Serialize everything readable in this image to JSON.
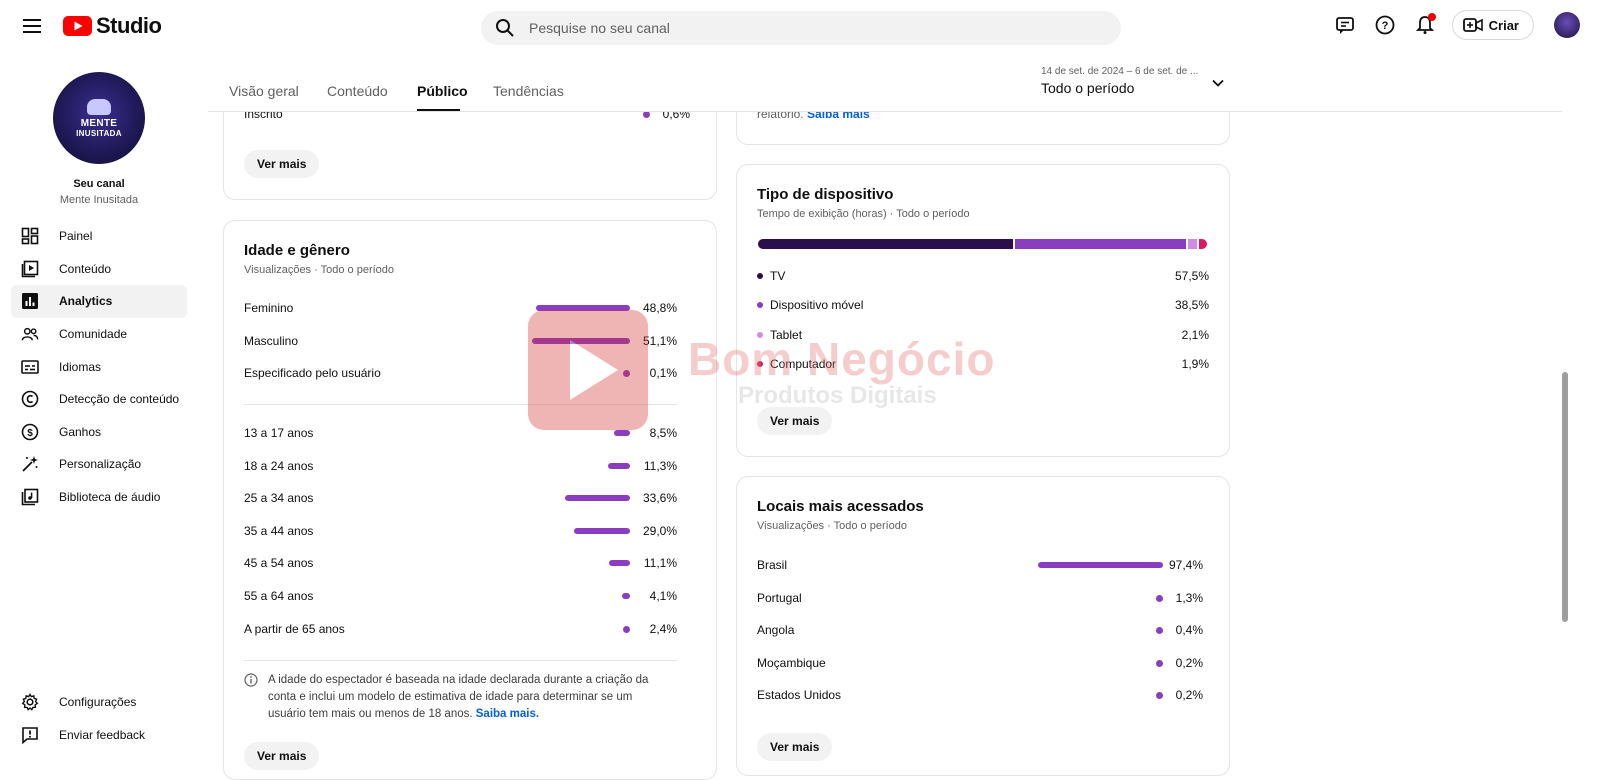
{
  "header": {
    "logo_text": "Studio",
    "search_placeholder": "Pesquise no seu canal",
    "create_label": "Criar"
  },
  "sidebar": {
    "channel_avatar_line1": "MENTE",
    "channel_avatar_line2": "INUSITADA",
    "channel_title": "Seu canal",
    "channel_name": "Mente Inusitada",
    "items": [
      {
        "label": "Painel",
        "icon": "dashboard-icon"
      },
      {
        "label": "Conteúdo",
        "icon": "content-icon"
      },
      {
        "label": "Analytics",
        "icon": "analytics-icon",
        "active": true
      },
      {
        "label": "Comunidade",
        "icon": "community-icon"
      },
      {
        "label": "Idiomas",
        "icon": "subtitles-icon"
      },
      {
        "label": "Detecção de conteúdo",
        "icon": "copyright-icon"
      },
      {
        "label": "Ganhos",
        "icon": "dollar-icon"
      },
      {
        "label": "Personalização",
        "icon": "magic-wand-icon"
      },
      {
        "label": "Biblioteca de áudio",
        "icon": "audio-library-icon"
      }
    ],
    "bottom_items": [
      {
        "label": "Configurações",
        "icon": "gear-icon"
      },
      {
        "label": "Enviar feedback",
        "icon": "feedback-icon"
      }
    ]
  },
  "tabs": [
    {
      "label": "Visão geral"
    },
    {
      "label": "Conteúdo"
    },
    {
      "label": "Público",
      "active": true
    },
    {
      "label": "Tendências"
    }
  ],
  "period": {
    "range": "14 de set. de 2024 – 6 de set. de ...",
    "label": "Todo o período"
  },
  "top_left_card": {
    "row_label": "Inscrito",
    "row_value": "0,6%",
    "button": "Ver mais"
  },
  "top_right_card": {
    "text": "relatório.",
    "link": "Saiba mais"
  },
  "age_gender": {
    "title": "Idade e gênero",
    "subtitle": "Visualizações · Todo o período",
    "gender": [
      {
        "label": "Feminino",
        "value": "48,8%",
        "num": 48.8
      },
      {
        "label": "Masculino",
        "value": "51,1%",
        "num": 51.1
      },
      {
        "label": "Especificado pelo usuário",
        "value": "0,1%",
        "num": 0.1
      }
    ],
    "ages": [
      {
        "label": "13 a 17 anos",
        "value": "8,5%",
        "num": 8.5
      },
      {
        "label": "18 a 24 anos",
        "value": "11,3%",
        "num": 11.3
      },
      {
        "label": "25 a 34 anos",
        "value": "33,6%",
        "num": 33.6
      },
      {
        "label": "35 a 44 anos",
        "value": "29,0%",
        "num": 29.0
      },
      {
        "label": "45 a 54 anos",
        "value": "11,1%",
        "num": 11.1
      },
      {
        "label": "55 a 64 anos",
        "value": "4,1%",
        "num": 4.1
      },
      {
        "label": "A partir de 65 anos",
        "value": "2,4%",
        "num": 2.4
      }
    ],
    "info_text": "A idade do espectador é baseada na idade declarada durante a criação da conta e inclui um modelo de estimativa de idade para determinar se um usuário tem mais ou menos de 18 anos.",
    "info_link": "Saiba mais.",
    "button": "Ver mais"
  },
  "device": {
    "title": "Tipo de dispositivo",
    "subtitle": "Tempo de exibição (horas) · Todo o período",
    "items": [
      {
        "label": "TV",
        "value": "57,5%",
        "num": 57.5,
        "color": "#2b0f4d"
      },
      {
        "label": "Dispositivo móvel",
        "value": "38,5%",
        "num": 38.5,
        "color": "#8b3dbf"
      },
      {
        "label": "Tablet",
        "value": "2,1%",
        "num": 2.1,
        "color": "#d38be0"
      },
      {
        "label": "Computador",
        "value": "1,9%",
        "num": 1.9,
        "color": "#d81b60"
      }
    ],
    "button": "Ver mais"
  },
  "locations": {
    "title": "Locais mais acessados",
    "subtitle": "Visualizações · Todo o período",
    "items": [
      {
        "label": "Brasil",
        "value": "97,4%",
        "num": 97.4
      },
      {
        "label": "Portugal",
        "value": "1,3%",
        "num": 1.3
      },
      {
        "label": "Angola",
        "value": "0,4%",
        "num": 0.4
      },
      {
        "label": "Moçambique",
        "value": "0,2%",
        "num": 0.2
      },
      {
        "label": "Estados Unidos",
        "value": "0,2%",
        "num": 0.2
      }
    ],
    "button": "Ver mais"
  },
  "watermark": {
    "line1": "Bom Negócio",
    "line2": "Produtos Digitais"
  },
  "colors": {
    "bar": "#8b3dbf",
    "link": "#065fd4",
    "brand_red": "#ff0000"
  }
}
